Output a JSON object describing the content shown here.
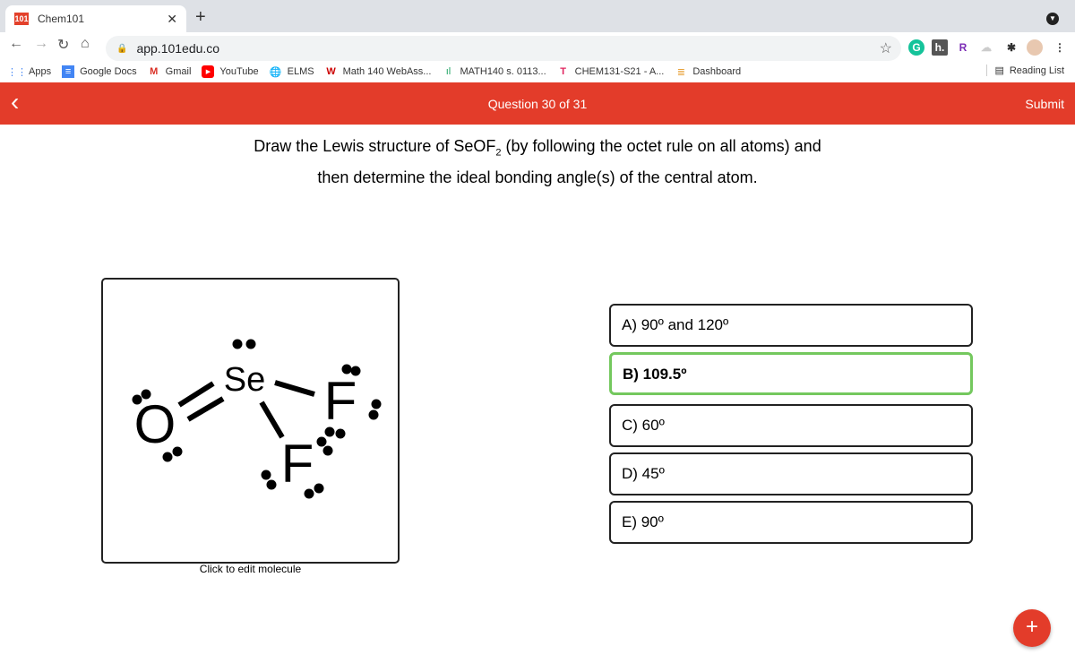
{
  "browser": {
    "tab_title": "Chem101",
    "tab_favicon": "101",
    "url": "app.101edu.co",
    "bookmarks": [
      "Apps",
      "Google Docs",
      "Gmail",
      "YouTube",
      "ELMS",
      "Math 140 WebAss...",
      "MATH140 s. 0113...",
      "CHEM131-S21 - A...",
      "Dashboard"
    ],
    "reading_list": "Reading List",
    "extensions": [
      "grammarly-icon",
      "h-icon",
      "r-icon",
      "cloud-icon",
      "puzzle-icon",
      "profile-avatar",
      "more-icon"
    ]
  },
  "header": {
    "progress": "Question 30 of 31",
    "submit": "Submit",
    "accent": "#e33c2a"
  },
  "question": {
    "line1_pre": "Draw the Lewis structure of SeOF",
    "line1_sub": "2",
    "line1_post": " (by following the octet rule on all atoms) and",
    "line2": "then determine the ideal bonding angle(s) of the central atom."
  },
  "molecule": {
    "atoms": [
      "Se",
      "O",
      "F",
      "F"
    ],
    "hint": "Click to edit molecule"
  },
  "options": [
    {
      "label": "A) 90º and 120º",
      "selected": false
    },
    {
      "label": "B) 109.5º",
      "selected": true
    },
    {
      "label": "C) 60º",
      "selected": false
    },
    {
      "label": "D) 45º",
      "selected": false
    },
    {
      "label": "E) 90º",
      "selected": false
    }
  ],
  "selected_color": "#74c85e",
  "fab": "+"
}
